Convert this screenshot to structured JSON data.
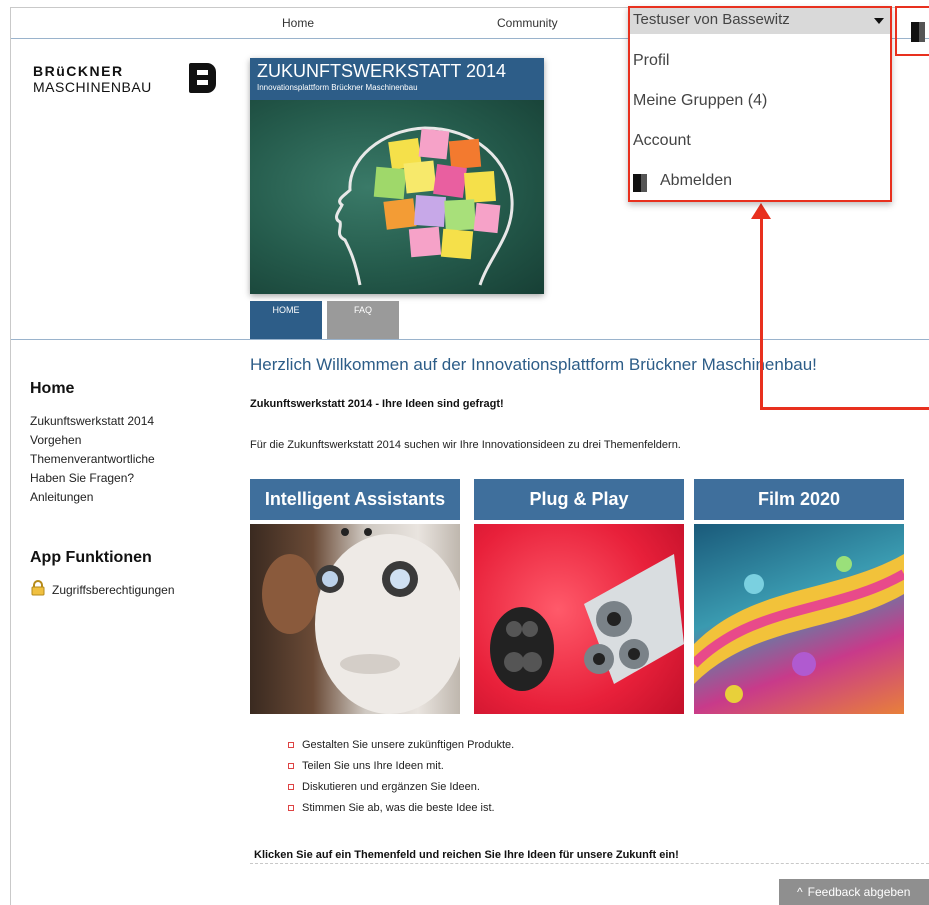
{
  "topnav": {
    "home": "Home",
    "community": "Community"
  },
  "logo": {
    "line1": "BRüCKNER",
    "line2": "MASCHINENBAU",
    "mark_icon": "brueckner-b-logo-icon"
  },
  "banner": {
    "title": "ZUKUNFTSWERKSTATT 2014",
    "subtitle": "Innovationsplattform Brückner Maschinenbau",
    "tabs": [
      "HOME",
      "FAQ"
    ]
  },
  "sidebar": {
    "home_heading": "Home",
    "links": [
      "Zukunftswerkstatt 2014",
      "Vorgehen",
      "Themenverantwortliche",
      "Haben Sie Fragen?",
      "Anleitungen"
    ],
    "app_heading": "App Funktionen",
    "app_link": "Zugriffsberechtigungen",
    "app_link_icon": "lock-icon"
  },
  "main": {
    "title": "Herzlich Willkommen auf der Innovationsplattform Brückner Maschinenbau!",
    "subtitle": "Zukunftswerkstatt 2014 - Ihre Ideen sind gefragt!",
    "intro": "Für die Zukunftswerkstatt 2014 suchen wir Ihre Innovationsideen zu drei Themenfeldern.",
    "cards": [
      {
        "title": "Intelligent Assistants"
      },
      {
        "title": "Plug & Play"
      },
      {
        "title": "Film 2020"
      }
    ],
    "bullets": [
      "Gestalten Sie unsere zukünftigen Produkte.",
      "Teilen Sie uns Ihre Ideen mit.",
      "Diskutieren und ergänzen Sie Ideen.",
      "Stimmen Sie ab, was die beste Idee ist."
    ],
    "cta": "Klicken Sie auf ein Themenfeld und reichen Sie Ihre Ideen für unsere Zukunft ein!"
  },
  "user_menu": {
    "user": "Testuser von Bassewitz",
    "items": [
      "Profil",
      "Meine Gruppen (4)",
      "Account",
      "Abmelden"
    ],
    "logout_icon": "door-exit-icon"
  },
  "feedback": {
    "label": "Feedback abgeben"
  },
  "colors": {
    "accent_blue": "#2d5d88",
    "card_blue": "#3f6f9c",
    "highlight_red": "#e8301e"
  }
}
